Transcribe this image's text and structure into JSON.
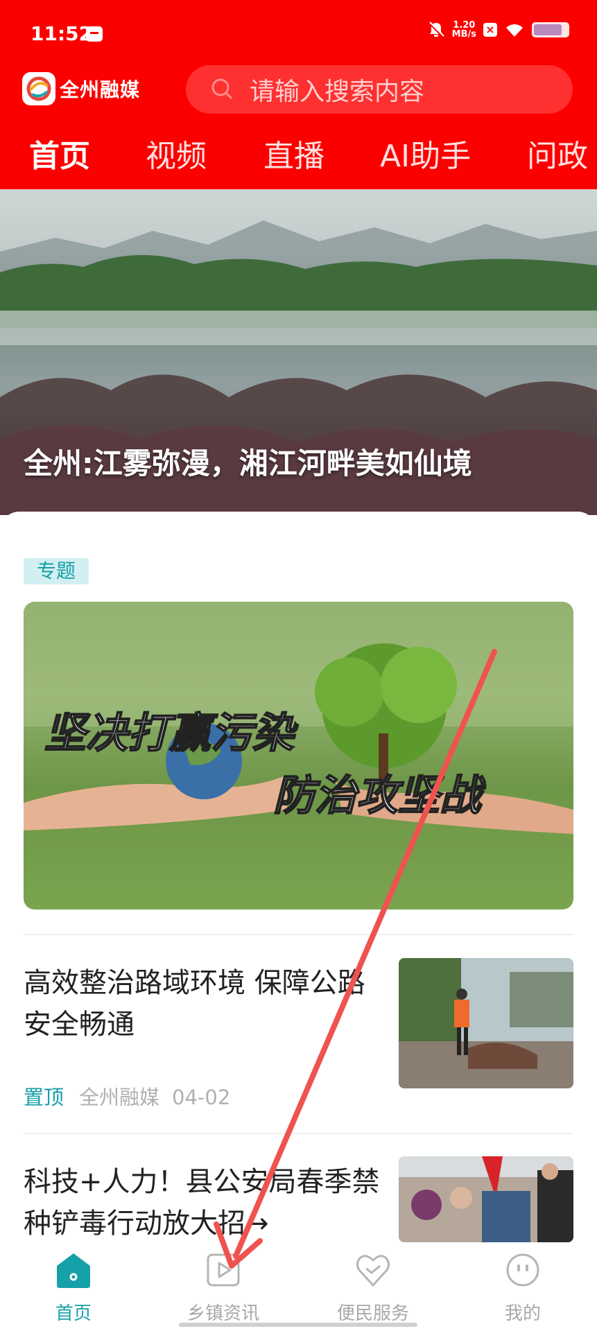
{
  "status_bar": {
    "time": "11:52",
    "net_speed_value": "1.20",
    "net_speed_unit": "MB/s"
  },
  "header": {
    "app_name": "全州融媒",
    "search_placeholder": "请输入搜索内容"
  },
  "tabs": [
    {
      "label": "首页",
      "active": true
    },
    {
      "label": "视频",
      "active": false
    },
    {
      "label": "直播",
      "active": false
    },
    {
      "label": "AI助手",
      "active": false
    },
    {
      "label": "问政",
      "active": false
    }
  ],
  "hero": {
    "caption": "全州:江雾弥漫，湘江河畔美如仙境"
  },
  "topic": {
    "tag": "专题",
    "banner_line1": "坚决打赢污染",
    "banner_line2": "防治攻坚战"
  },
  "news": [
    {
      "title": "高效整治路域环境 保障公路安全畅通",
      "pin": "置顶",
      "source": "全州融媒",
      "date": "04-02"
    },
    {
      "title": "科技+人力！县公安局春季禁种铲毒行动放大招→"
    }
  ],
  "bottom_nav": [
    {
      "label": "首页",
      "icon": "home-icon",
      "active": true
    },
    {
      "label": "乡镇资讯",
      "icon": "play-icon",
      "active": false
    },
    {
      "label": "便民服务",
      "icon": "heart-icon",
      "active": false
    },
    {
      "label": "我的",
      "icon": "face-icon",
      "active": false
    }
  ],
  "colors": {
    "brand_red": "#fc0000",
    "accent_teal": "#16a0a8",
    "annotation_arrow": "#ef5350"
  }
}
